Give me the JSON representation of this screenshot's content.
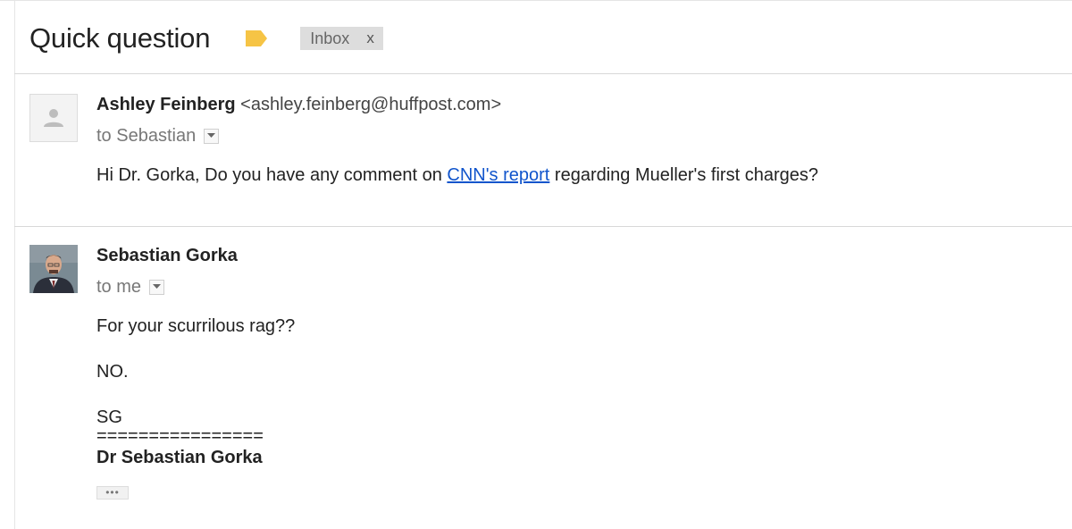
{
  "thread": {
    "subject": "Quick question",
    "label_chip": "Inbox",
    "label_chip_remove": "x",
    "label_color": "#f6c445"
  },
  "messages": [
    {
      "sender_name": "Ashley Feinberg",
      "sender_email": "<ashley.feinberg@huffpost.com>",
      "recipient": "to Sebastian",
      "body_before_link": "Hi Dr. Gorka, Do you have any comment on ",
      "link_text": "CNN's report",
      "body_after_link": " regarding Mueller's first charges?"
    },
    {
      "sender_name": "Sebastian Gorka",
      "recipient": "to me",
      "line1": "For your scurrilous rag??",
      "line2": "NO.",
      "line3": "SG",
      "separator": "================",
      "signature": "Dr Sebastian Gorka",
      "trimmed_content": "•••"
    }
  ],
  "colors": {
    "link": "#1155cc",
    "divider": "#d8d8d8",
    "chip_bg": "#dddddd"
  }
}
